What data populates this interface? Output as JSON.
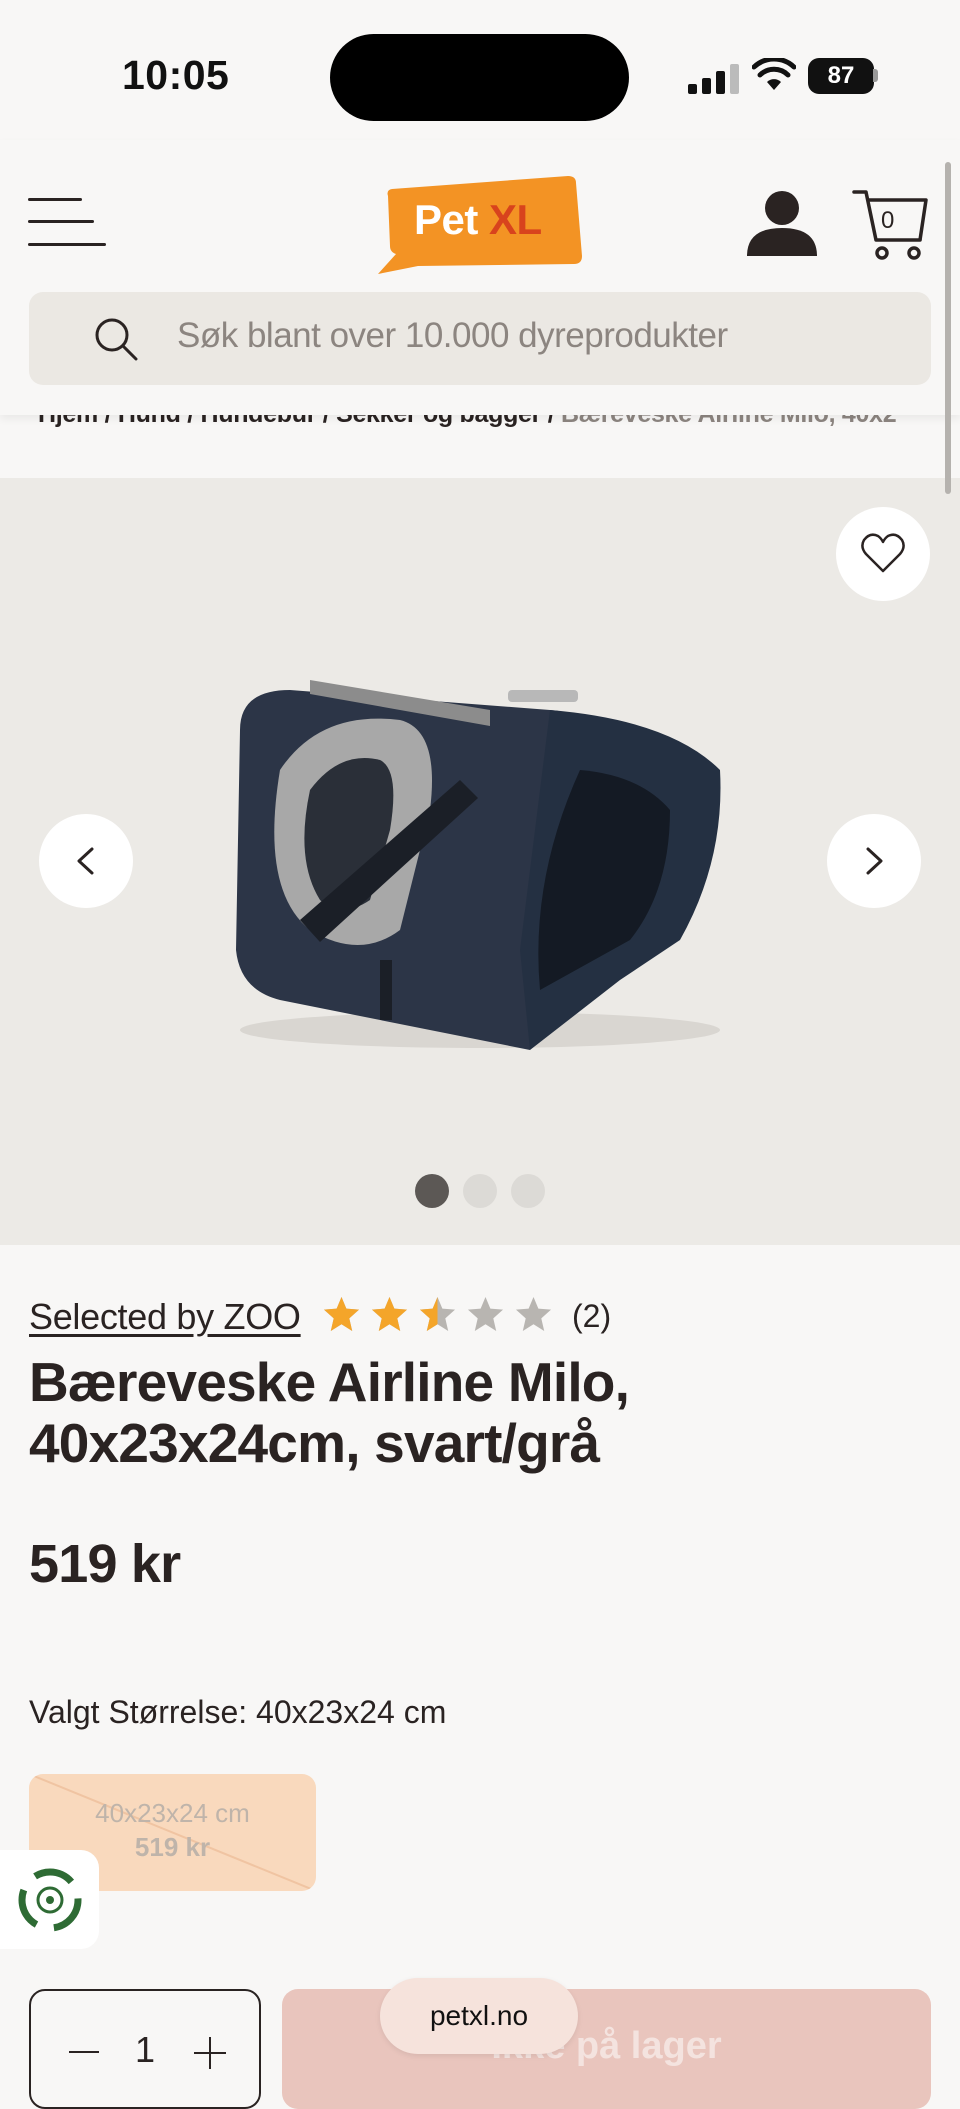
{
  "status_bar": {
    "time": "10:05",
    "battery": "87"
  },
  "header": {
    "logo_part1": "Pet",
    "logo_part2": "XL",
    "cart_count": "0",
    "search_placeholder": "Søk blant over 10.000 dyreprodukter"
  },
  "breadcrumb": {
    "items": [
      "Hjem",
      "Hund",
      "Hundebur",
      "Sekker og bagger"
    ],
    "separator": " / ",
    "current": "Bæreveske Airline Milo, 40x2"
  },
  "gallery": {
    "image_count": 3,
    "active_index": 0
  },
  "product": {
    "brand": "Selected by ZOO",
    "rating": 2.5,
    "rating_max": 5,
    "review_count": "(2)",
    "title": "Bæreveske Airline Milo, 40x23x24cm, svart/grå",
    "price": "519 kr"
  },
  "size": {
    "label": "Valgt Størrelse: 40x23x24 cm",
    "option_size": "40x23x24 cm",
    "option_price": "519 kr"
  },
  "purchase": {
    "quantity": "1",
    "stock_button": "Ikke på lager"
  },
  "browser": {
    "url": "petxl.no"
  },
  "colors": {
    "logo_orange": "#f39324",
    "logo_red": "#d8431d",
    "star_gold": "#f4a52a",
    "star_gray": "#b8b5b1",
    "text_dark": "#2a2322"
  }
}
